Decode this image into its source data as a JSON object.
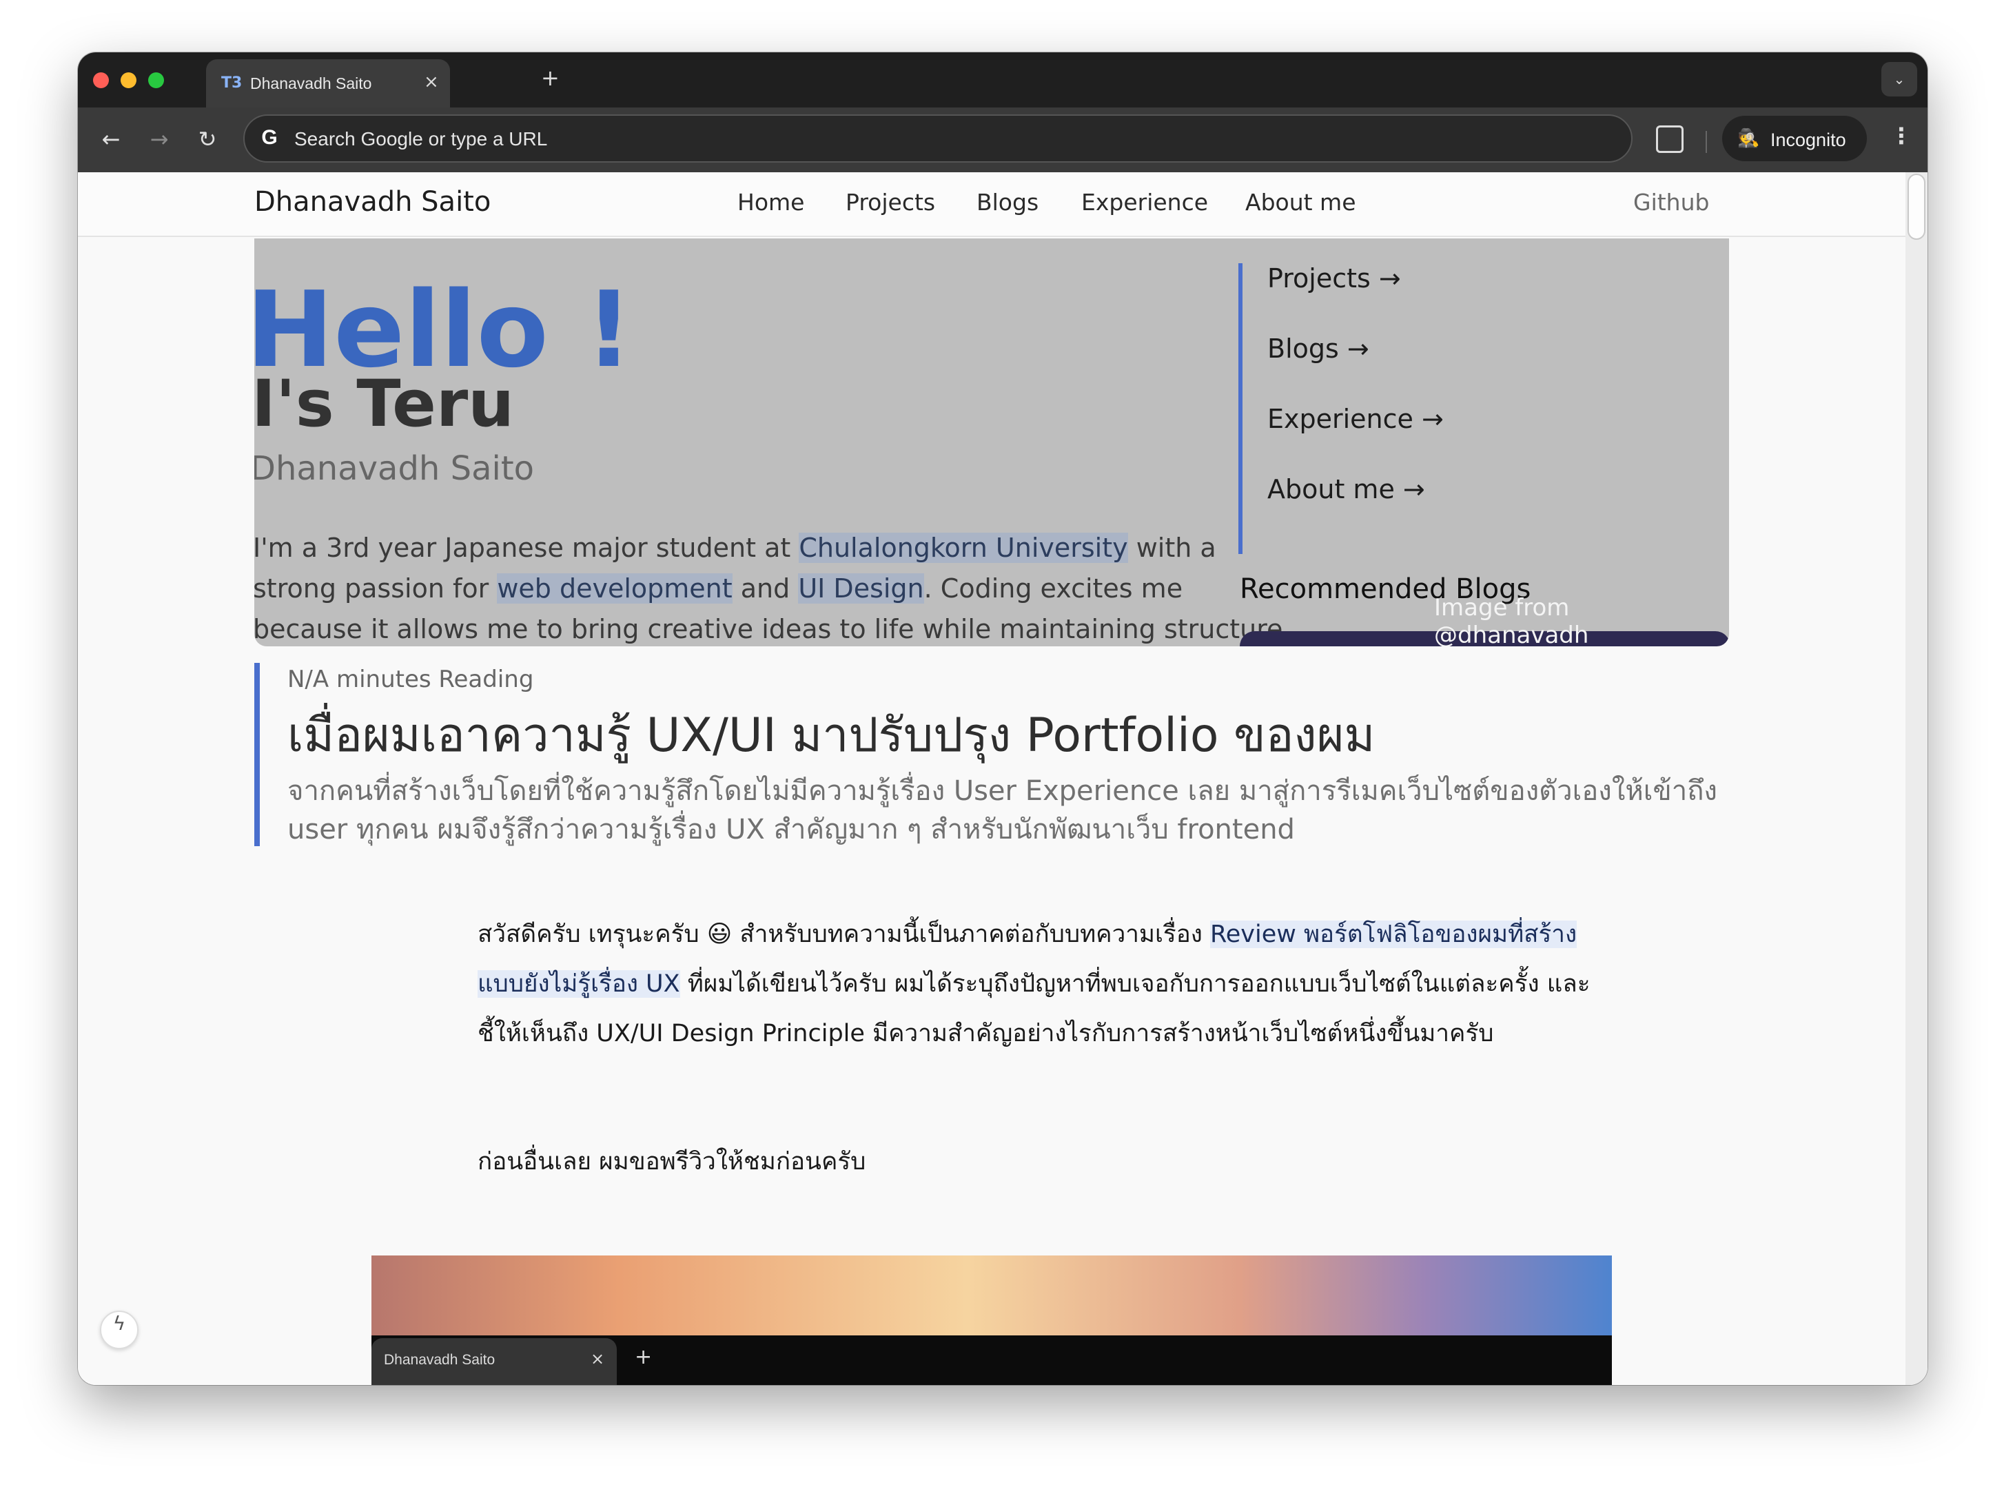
{
  "browser": {
    "tab_title": "Dhanavadh Saito",
    "tab_icon": "T3",
    "tab_close": "×",
    "new_tab": "+",
    "tab_menu": "⌄",
    "back": "←",
    "forward": "→",
    "reload": "↻",
    "google_icon": "G",
    "omnibox_placeholder": "Search Google or type a URL",
    "incognito_label": "Incognito",
    "menu": "⋮",
    "colors": {
      "close": "#ff5f57",
      "minimize": "#febc2e",
      "zoom": "#28c840"
    }
  },
  "site": {
    "brand": "Dhanavadh Saito",
    "nav": [
      "Home",
      "Projects",
      "Blogs",
      "Experience",
      "About me"
    ],
    "github": "Github"
  },
  "hero": {
    "hello": "Hello !",
    "teru": "I's Teru",
    "name": "Dhanavadh Saito",
    "intro_line1_pre": "I'm a 3rd year Japanese major student at ",
    "intro_line1_hl": "Chulalongkorn University",
    "intro_line1_post": " with a",
    "intro_line2_pre": "strong passion for ",
    "intro_line2_hl1": "web development",
    "intro_line2_mid": " and ",
    "intro_line2_hl2": "UI Design",
    "intro_line2_post": ". Coding excites me",
    "intro_line3": "because it allows me to bring creative ideas to life while maintaining structure",
    "side_links": [
      "Projects →",
      "Blogs →",
      "Experience →",
      "About me →"
    ],
    "recommended": "Recommended Blogs",
    "credit": "Image from @dhanavadh"
  },
  "article": {
    "reading": "N/A minutes Reading",
    "title": "เมื่อผมเอาความรู้ UX/UI มาปรับปรุง Portfolio ของผม",
    "subtitle": "จากคนที่สร้างเว็บโดยที่ใช้ความรู้สึกโดยไม่มีความรู้เรื่อง User Experience เลย มาสู่การรีเมคเว็บไซต์ของตัวเองให้เข้าถึง user ทุกคน ผมจึงรู้สึกว่าความรู้เรื่อง UX สำคัญมาก ๆ สำหรับนักพัฒนาเว็บ frontend",
    "p1_pre": "สวัสดีครับ เทรุนะครับ 😃 สำหรับบทความนี้เป็นภาคต่อกับบทความเรื่อง ",
    "p1_link": "Review พอร์ตโฟลิโอของผมที่สร้างแบบยังไม่รู้เรื่อง UX",
    "p1_post": " ที่ผมได้เขียนไว้ครับ ผมได้ระบุถึงปัญหาที่พบเจอกับการออกแบบเว็บไซต์ในแต่ละครั้ง และชี้ให้เห็นถึง UX/UI Design Principle มีความสำคัญอย่างไรกับการสร้างหน้าเว็บไซต์หนึ่งขึ้นมาครับ",
    "p2": "ก่อนอื่นเลย ผมขอพรีวิวให้ชมก่อนครับ",
    "screenshot_tab_title": "Dhanavadh Saito",
    "screenshot_tab_close": "×",
    "screenshot_new_tab": "+"
  },
  "fab_icon": "ϟ"
}
